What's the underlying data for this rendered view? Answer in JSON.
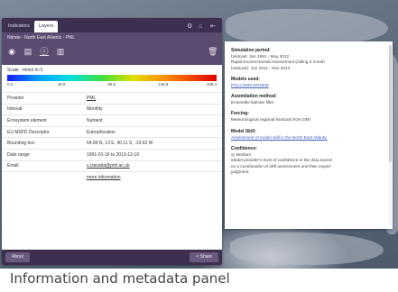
{
  "tabs": [
    {
      "label": "Indicators"
    },
    {
      "label": "Layers"
    }
  ],
  "layer": {
    "title": "Nitrate - North East Atlantic - PML",
    "icons": [
      "eye-icon",
      "document-icon",
      "info-icon",
      "chart-icon"
    ]
  },
  "scale": {
    "label": "Scale - mmol m-3",
    "ticks": [
      "0.2",
      "49.8",
      "99.6",
      "148.8",
      "198.4"
    ]
  },
  "metadata": [
    {
      "key": "Provider",
      "value": "PML",
      "link": true
    },
    {
      "key": "Interval",
      "value": "Monthly",
      "link": false
    },
    {
      "key": "Ecosystem element",
      "value": "Nutrient",
      "link": false
    },
    {
      "key": "EU MSFD Descriptor",
      "value": "Eutrophication",
      "link": false
    },
    {
      "key": "Bounding box",
      "value": "64.89 N, 13 E, 40.11 S, -19.63 W",
      "link": false
    },
    {
      "key": "Date range",
      "value": "1991-01-16 to 2013-12-16",
      "link": false
    },
    {
      "key": "Email",
      "value": "s.ciavatta@pml.ac.uk",
      "link": true
    },
    {
      "key": "",
      "value": "more information",
      "link": true
    }
  ],
  "footer": {
    "about_label": "About",
    "share_label": "< Share"
  },
  "info": {
    "sections": [
      {
        "heading": "Simulation period:",
        "lines": [
          "hindcast: Jan 1991 - May 2012",
          "Rapid Environmental Assessment (rolling 3 month",
          "hindcast): Jun 2012 - Nov 2013"
        ],
        "style": ""
      },
      {
        "heading": "Models used:",
        "lines": [
          "POLCOMS-ERSEM"
        ],
        "style": "link"
      },
      {
        "heading": "Assimilation method:",
        "lines": [
          "Ensemble kalman filter"
        ],
        "style": ""
      },
      {
        "heading": "Forcing:",
        "lines": [
          "Meteorological regional hindcast from DMI"
        ],
        "style": ""
      },
      {
        "heading": "Model Skill:",
        "lines": [
          "Assessment of model skill in the North East Atlantic"
        ],
        "style": "link"
      },
      {
        "heading": "Confidence:",
        "lines": [
          "Medium",
          "Model provider's level of confidence in the data based",
          "on a combination of skill assessment and their expert",
          "judgment."
        ],
        "style": "it"
      }
    ]
  },
  "caption": "Information and metadata panel",
  "colors": {
    "header_dark": "#3d2f4f",
    "header_mid": "#5b4b70",
    "link": "#3a5bbd"
  }
}
